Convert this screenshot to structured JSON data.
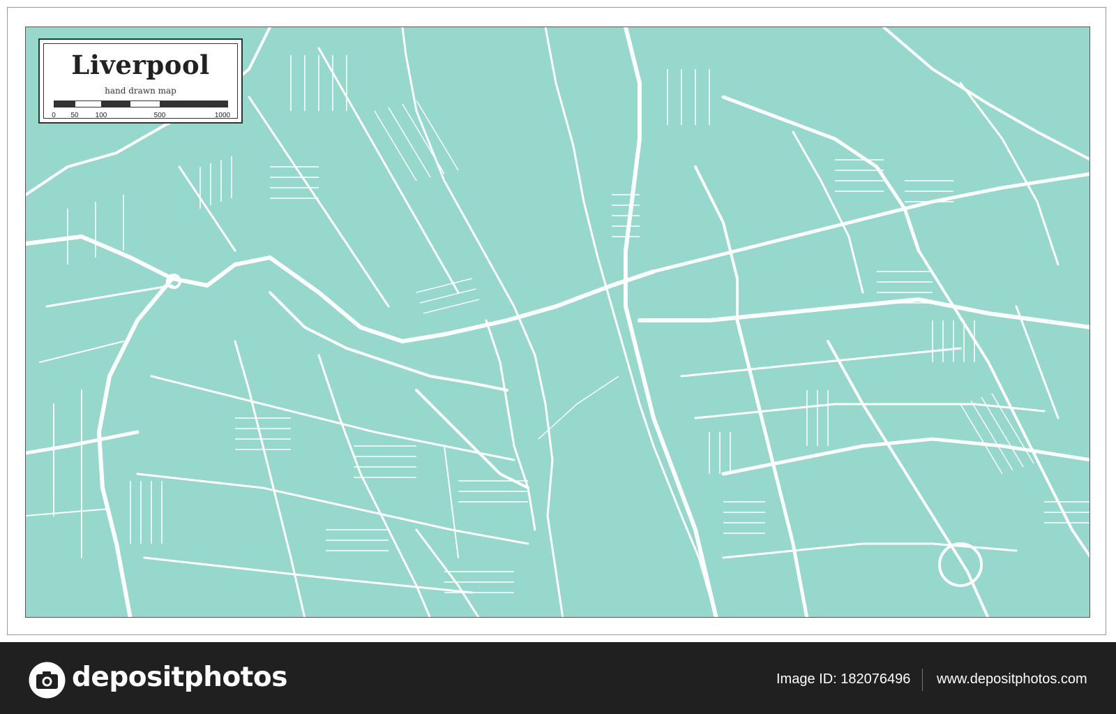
{
  "map": {
    "title": "Liverpool",
    "subtitle": "hand drawn map",
    "scale_labels": [
      "0",
      "50",
      "100",
      "500",
      "1000"
    ],
    "colors": {
      "land": "#96d8cb",
      "water": "#96d8cb",
      "roads": "#ffffff",
      "frame": "#333333"
    }
  },
  "footer": {
    "brand": "depositphotos",
    "brand_icon": "camera-icon",
    "image_id_label": "Image ID:",
    "image_id": "182076496",
    "url": "www.depositphotos.com",
    "background": "#202020"
  }
}
